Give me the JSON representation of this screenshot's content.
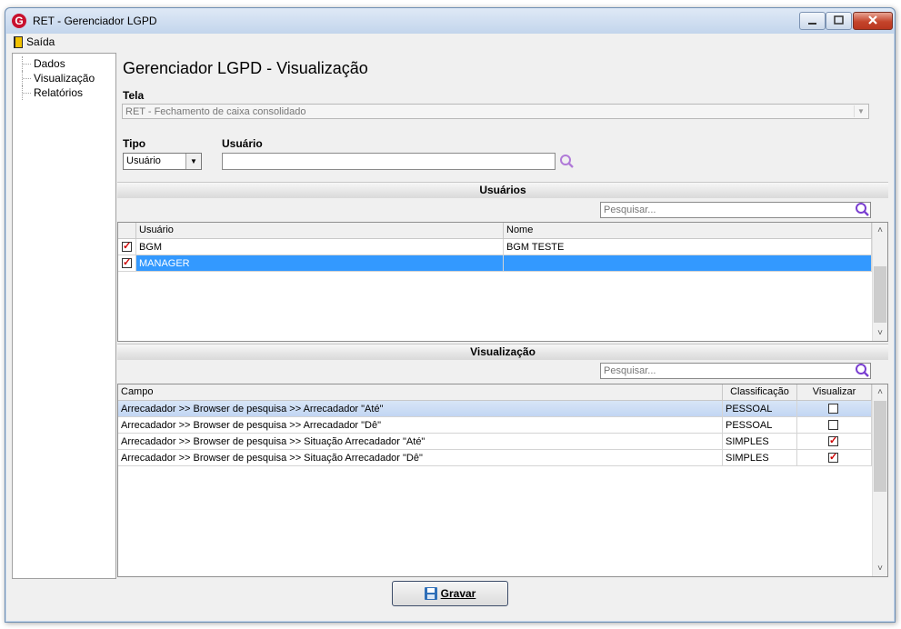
{
  "window": {
    "title": "RET - Gerenciador LGPD"
  },
  "menu": {
    "exit_label": "Saída"
  },
  "nav": {
    "items": [
      "Dados",
      "Visualização",
      "Relatórios"
    ]
  },
  "page_title": "Gerenciador LGPD - Visualização",
  "tela": {
    "label": "Tela",
    "value": "RET - Fechamento de caixa consolidado"
  },
  "tipo": {
    "label": "Tipo",
    "value": "Usuário"
  },
  "usuario": {
    "label": "Usuário",
    "value": ""
  },
  "usuarios_section": {
    "title": "Usuários",
    "search_placeholder": "Pesquisar...",
    "columns": [
      "Usuário",
      "Nome"
    ],
    "rows": [
      {
        "checked": true,
        "usuario": "BGM",
        "nome": "BGM TESTE"
      },
      {
        "checked": true,
        "usuario": "MANAGER",
        "nome": ""
      }
    ]
  },
  "visualizacao_section": {
    "title": "Visualização",
    "search_placeholder": "Pesquisar...",
    "columns": [
      "Campo",
      "Classificação",
      "Visualizar"
    ],
    "rows": [
      {
        "campo": "Arrecadador >> Browser de pesquisa >> Arrecadador \"Até\"",
        "classificacao": "PESSOAL",
        "visualizar": false
      },
      {
        "campo": "Arrecadador >> Browser de pesquisa >> Arrecadador \"Dê\"",
        "classificacao": "PESSOAL",
        "visualizar": false
      },
      {
        "campo": "Arrecadador >> Browser de pesquisa >> Situação Arrecadador \"Até\"",
        "classificacao": "SIMPLES",
        "visualizar": true
      },
      {
        "campo": "Arrecadador >> Browser de pesquisa >> Situação Arrecadador \"Dê\"",
        "classificacao": "SIMPLES",
        "visualizar": true
      }
    ]
  },
  "save_button": {
    "label": "Gravar"
  },
  "colors": {
    "selection": "#3399ff",
    "accent_search": "#7a3fd1",
    "check_mark": "#d00000"
  }
}
